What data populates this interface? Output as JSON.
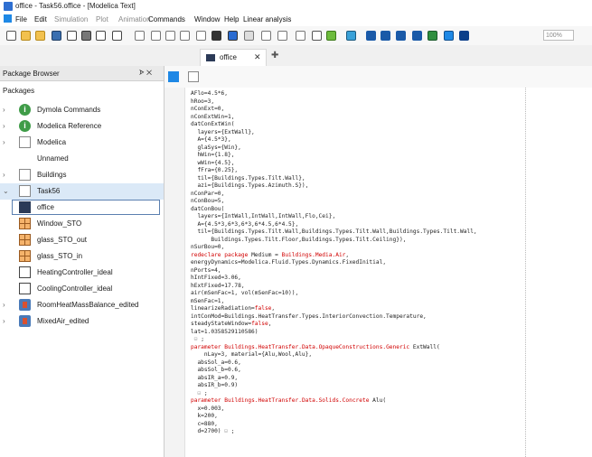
{
  "window": {
    "title": "office - Task56.office - [Modelica Text]"
  },
  "menu": [
    "File",
    "Edit",
    "Simulation",
    "Plot",
    "Animation",
    "Commands",
    "Window",
    "Help",
    "Linear analysis"
  ],
  "menu_dim": [
    false,
    false,
    true,
    true,
    true,
    false,
    false,
    false,
    false
  ],
  "toolbar": {
    "zoom": "100%"
  },
  "tabs": [
    {
      "label": "office"
    }
  ],
  "sidebar": {
    "title": "Package Browser",
    "pin": "ᗎ ✕",
    "section_label": "Packages",
    "items": [
      {
        "label": "Dymola Commands",
        "icon": "info-icon",
        "arrow": ">"
      },
      {
        "label": "Modelica Reference",
        "icon": "info-icon",
        "arrow": ">"
      },
      {
        "label": "Modelica",
        "icon": "modelica-icon",
        "arrow": ">"
      },
      {
        "label": "Unnamed",
        "icon": "",
        "arrow": ""
      },
      {
        "label": "Buildings",
        "icon": "package-icon",
        "arrow": ">"
      },
      {
        "label": "Task56",
        "icon": "package-icon",
        "arrow": "v"
      },
      {
        "label": "office",
        "icon": "model-icon",
        "arrow": ""
      },
      {
        "label": "Window_STO",
        "icon": "record-icon",
        "arrow": ""
      },
      {
        "label": "glass_STO_out",
        "icon": "record-icon",
        "arrow": ""
      },
      {
        "label": "glass_STO_in",
        "icon": "record-icon",
        "arrow": ""
      },
      {
        "label": "HeatingController_ideal",
        "icon": "block-icon",
        "arrow": ""
      },
      {
        "label": "CoolingController_ideal",
        "icon": "block-icon",
        "arrow": ""
      },
      {
        "label": "RoomHeatMassBalance_edited",
        "icon": "room-icon",
        "arrow": ">"
      },
      {
        "label": "MixedAir_edited",
        "icon": "room-icon",
        "arrow": ">"
      }
    ]
  },
  "code_lines": [
    "AFlo=4.5*6,",
    "hRoo=3,",
    "nConExt=0,",
    "nConExtWin=1,",
    "datConExtWin(",
    "  layers={ExtWall},",
    "  A={4.5*3},",
    "  glaSys={Win},",
    "  hWin={1.8},",
    "  wWin={4.5},",
    "  fFra={0.25},",
    "  til={Buildings.Types.Tilt.Wall},",
    "  azi={Buildings.Types.Azimuth.S}),",
    "nConPar=0,",
    "nConBou=5,",
    "datConBou(",
    "  layers={IntWall,IntWall,IntWall,Flo,Cei},",
    "  A={4.5*3,6*3,6*3,6*4.5,6*4.5},",
    "  til={Buildings.Types.Tilt.Wall,Buildings.Types.Tilt.Wall,Buildings.Types.Tilt.Wall,",
    "      Buildings.Types.Tilt.Floor,Buildings.Types.Tilt.Ceiling}),",
    "nSurBou=0,",
    "redeclare package Medium = Buildings.Media.Air,",
    "energyDynamics=Modelica.Fluid.Types.Dynamics.FixedInitial,",
    "nPorts=4,",
    "hIntFixed=3.06,",
    "hExtFixed=17.78,",
    "air(mSenFac=1, vol(mSenFac=10)),",
    "mSenFac=1,",
    "linearizeRadiation=false,",
    "intConMod=Buildings.HeatTransfer.Types.InteriorConvection.Temperature,",
    "steadyStateWindow=false,",
    "lat=1.0358529110586)",
    " ⊟ ;",
    "parameter Buildings.HeatTransfer.Data.OpaqueConstructions.Generic ExtWall(",
    "    nLay=3, material={Alu,Wool,Alu},",
    "  absSol_a=0.6,",
    "  absSol_b=0.6,",
    "  absIR_a=0.9,",
    "  absIR_b=0.9)",
    "  ⊟ ;",
    "parameter Buildings.HeatTransfer.Data.Solids.Concrete Alu(",
    "  x=0.003,",
    "  k=200,",
    "  c=880,",
    "  d=2700) ⊟ ;"
  ]
}
